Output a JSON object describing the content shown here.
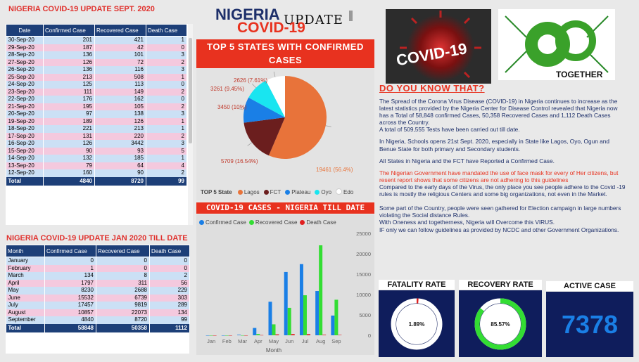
{
  "sept_title": "NIGERIA COVID-19 UPDATE SEPT. 2020",
  "sept_table": {
    "columns": [
      "Date",
      "Confirmed Case",
      "Recovered Case",
      "Death Case"
    ],
    "rows": [
      [
        "30-Sep-20",
        "201",
        "421",
        "1"
      ],
      [
        "29-Sep-20",
        "187",
        "42",
        "0"
      ],
      [
        "28-Sep-20",
        "136",
        "101",
        "3"
      ],
      [
        "27-Sep-20",
        "126",
        "72",
        "2"
      ],
      [
        "26-Sep-20",
        "136",
        "116",
        "3"
      ],
      [
        "25-Sep-20",
        "213",
        "508",
        "1"
      ],
      [
        "24-Sep-20",
        "125",
        "113",
        "0"
      ],
      [
        "23-Sep-20",
        "111",
        "149",
        "2"
      ],
      [
        "22-Sep-20",
        "176",
        "162",
        "0"
      ],
      [
        "21-Sep-20",
        "195",
        "105",
        "2"
      ],
      [
        "20-Sep-20",
        "97",
        "138",
        "3"
      ],
      [
        "19-Sep-20",
        "189",
        "126",
        "1"
      ],
      [
        "18-Sep-20",
        "221",
        "213",
        "1"
      ],
      [
        "17-Sep-20",
        "131",
        "220",
        "2"
      ],
      [
        "16-Sep-20",
        "126",
        "3442",
        "3"
      ],
      [
        "15-Sep-20",
        "90",
        "93",
        "5"
      ],
      [
        "14-Sep-20",
        "132",
        "185",
        "1"
      ],
      [
        "13-Sep-20",
        "79",
        "64",
        "4"
      ],
      [
        "12-Sep-20",
        "160",
        "90",
        "2"
      ]
    ],
    "total": [
      "Total",
      "4840",
      "8720",
      "99"
    ]
  },
  "jan_title": "NIGERIA COVID-19 UPDATE JAN 2020 TILL DATE",
  "jan_table": {
    "columns": [
      "Month",
      "Confirmed Case",
      "Recovered Case",
      "Death Case"
    ],
    "rows": [
      [
        "January",
        "0",
        "0",
        "0"
      ],
      [
        "February",
        "1",
        "0",
        "0"
      ],
      [
        "March",
        "134",
        "8",
        "2"
      ],
      [
        "April",
        "1797",
        "311",
        "56"
      ],
      [
        "May",
        "8230",
        "2688",
        "229"
      ],
      [
        "June",
        "15532",
        "6739",
        "303"
      ],
      [
        "July",
        "17457",
        "9819",
        "289"
      ],
      [
        "August",
        "10857",
        "22073",
        "134"
      ],
      [
        "September",
        "4840",
        "8720",
        "99"
      ]
    ],
    "total": [
      "Total",
      "58848",
      "50358",
      "1112"
    ]
  },
  "header": {
    "nigeria": "NIGERIA",
    "update": "UPDATE",
    "covid": "COVID-19"
  },
  "top5": {
    "title": "TOP 5 STATES WITH CONFIRMED CASES",
    "legend_title": "TOP 5 State",
    "labels": [
      "19461 (56.4%)",
      "5709 (16.54%)",
      "3450 (10%)",
      "3261 (9.45%)",
      "2626 (7.61%)"
    ]
  },
  "images": {
    "covid_text": "COVID-19",
    "together": "TOGETHER"
  },
  "colors": {
    "lagos": "#e8733a",
    "fct": "#6b1e1e",
    "plateau": "#1a7fe6",
    "oyo": "#19e5f0",
    "edo": "#ffffff",
    "confirmed": "#1a7fe6",
    "recovered": "#33dd33",
    "death": "#e02020",
    "accent_red": "#e8321f",
    "navy": "#1d3f78"
  },
  "chart_data": [
    {
      "type": "pie",
      "title": "TOP 5 STATES WITH CONFIRMED CASES",
      "legend_title": "TOP 5 State",
      "categories": [
        "Lagos",
        "FCT",
        "Plateau",
        "Oyo",
        "Edo"
      ],
      "values": [
        19461,
        5709,
        3450,
        3261,
        2626
      ],
      "percent_labels": [
        "56.4%",
        "16.54%",
        "10%",
        "9.45%",
        "7.61%"
      ],
      "legend_placement": "bottom"
    },
    {
      "type": "bar",
      "title": "COVID-19 CASES - NIGERIA TILL DATE",
      "xlabel": "Month",
      "ylabel": "",
      "categories": [
        "Jan",
        "Feb",
        "Mar",
        "Apr",
        "May",
        "Jun",
        "Jul",
        "Aug",
        "Sep"
      ],
      "series": [
        {
          "name": "Confirmed Case",
          "values": [
            0,
            1,
            134,
            1797,
            8230,
            15532,
            17457,
            10857,
            4840
          ]
        },
        {
          "name": "Recovered Case",
          "values": [
            0,
            0,
            8,
            311,
            2688,
            6739,
            9819,
            22073,
            8720
          ]
        },
        {
          "name": "Death Case",
          "values": [
            0,
            0,
            2,
            56,
            229,
            303,
            289,
            134,
            99
          ]
        }
      ],
      "yticks": [
        "0",
        "5000",
        "10000",
        "15000",
        "20000",
        "25000"
      ],
      "ylim": [
        0,
        25000
      ],
      "legend_placement": "top-left",
      "grid": false
    }
  ],
  "info": {
    "title": "DO YOU KNOW THAT?",
    "p1": "The Spread of the Corona Virus Disease (COVID-19) in Nigeria continues to increase as the latest statistics provided by the Nigeria Center for Disease Control revealed that Nigeria now has a Total of 58,848 confirmed Cases, 50,358 Recovered Cases and 1,112 Death Cases  across the Country.",
    "p1b": "A total of 509,555 Tests have been carried out till date.",
    "p2": "In Nigeria, Schools opens 21st Sept. 2020, especially in State like Lagos, Oyo, Ogun and Benue State for both primary and Secondary students.",
    "p3": "All States in Nigeria and the FCT have Reported a Confirmed Case.",
    "p4_red": "The Nigerian Government have mandated the use of face mask for every of Her citizens, but resent report shows that some citizens are not adhering to this guidelines",
    "p4": "Compared to the early days of the Virus, the only place you see people adhere to the Covid -19 rules is mostly the religious Centers and some big organizations, not even in the Market.",
    "p5": "Some part of the Country, people were seen gathered for Election campaign in large numbers violating the Social distance Rules.",
    "p5b": "With Oneness and togetherness, Nigeria will Overcome this VIRUS.",
    "p5c": "IF only we can follow guidelines as provided by NCDC and other Government Organizations."
  },
  "kpis": {
    "fatality_title": "FATALITY RATE",
    "fatality_value": "1.89%",
    "fatality_fraction": 0.0189,
    "recovery_title": "RECOVERY RATE",
    "recovery_value": "85.57%",
    "recovery_fraction": 0.8557,
    "active_title": "ACTIVE CASE",
    "active_value": "7378"
  }
}
